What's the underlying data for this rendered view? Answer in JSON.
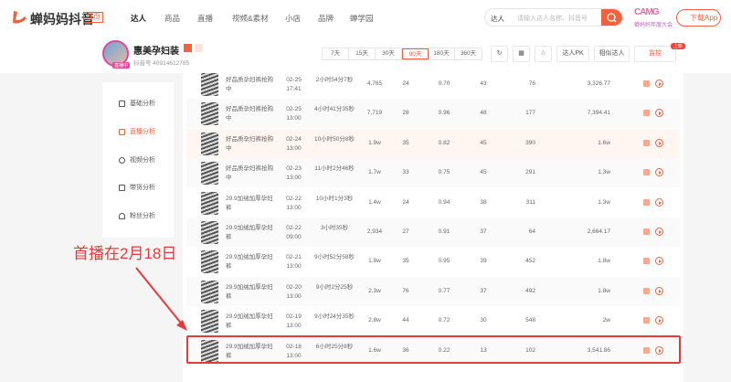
{
  "header": {
    "brand": "蝉妈妈抖音",
    "brand_tag": "首页",
    "nav": [
      "达人",
      "商品",
      "直播",
      "视频&素材",
      "小店",
      "品牌",
      "蝉学园"
    ],
    "search_type": "达人",
    "search_placeholder": "请输入达人名称、抖音号",
    "promo": "CAMG",
    "promo_sub": "蝉妈妈年度大会",
    "download": "下载App"
  },
  "profile": {
    "name": "惠美孕妇装",
    "live_badge": "直播中",
    "id": "抖音号 40914612785",
    "days": [
      "7天",
      "15天",
      "30天",
      "90天",
      "180天",
      "360天"
    ],
    "active_day": "90天",
    "pk": "达人PK",
    "similar": "相似达人",
    "monitor": "监控",
    "new_badge": "上新"
  },
  "sidebar": {
    "items": [
      {
        "label": "基础分析",
        "icon": "chart-icon"
      },
      {
        "label": "直播分析",
        "icon": "calendar-icon",
        "active": true
      },
      {
        "label": "视频分析",
        "icon": "play-icon"
      },
      {
        "label": "带货分析",
        "icon": "bag-icon"
      },
      {
        "label": "粉丝分析",
        "icon": "user-icon"
      }
    ]
  },
  "table": {
    "rows": [
      [
        "好品质孕妇裤抢购中",
        "02-25",
        "17:41",
        "2小时54分7秒",
        "4,765",
        "24",
        "0.70",
        "43",
        "76",
        "3,326.77"
      ],
      [
        "好品质孕妇裤抢购中",
        "02-25",
        "13:00",
        "4小时41分35秒",
        "7,719",
        "28",
        "0.96",
        "48",
        "177",
        "7,394.41"
      ],
      [
        "好品质孕妇裤抢购中",
        "02-24",
        "13:00",
        "10小时50分8秒",
        "1.9w",
        "35",
        "0.82",
        "45",
        "390",
        "1.6w"
      ],
      [
        "好品质孕妇裤抢购中",
        "02-23",
        "13:00",
        "11小时2分46秒",
        "1.7w",
        "33",
        "0.75",
        "45",
        "291",
        "1.3w"
      ],
      [
        "29.9加绒加厚孕妇裤",
        "02-22",
        "13:00",
        "10小时1分3秒",
        "1.4w",
        "24",
        "0.94",
        "38",
        "311",
        "1.3w"
      ],
      [
        "29.9加绒加厚孕妇裤",
        "02-22",
        "09:00",
        "3小时35秒",
        "2,934",
        "27",
        "0.91",
        "37",
        "64",
        "2,664.17"
      ],
      [
        "29.9加绒加厚孕妇裤",
        "02-21",
        "13:00",
        "9小时52分58秒",
        "1.8w",
        "35",
        "0.95",
        "39",
        "452",
        "1.8w"
      ],
      [
        "29.9加绒加厚孕妇裤",
        "02-20",
        "13:00",
        "9小时2分25秒",
        "2.3w",
        "76",
        "0.77",
        "37",
        "492",
        "1.8w"
      ],
      [
        "29.9加绒加厚孕妇裤",
        "02-19",
        "13:00",
        "9小时24分35秒",
        "2.8w",
        "44",
        "0.72",
        "30",
        "548",
        "2w"
      ],
      [
        "29.9加绒加厚孕妇裤",
        "02-18",
        "13:00",
        "6小时25分8秒",
        "1.6w",
        "36",
        "0.22",
        "13",
        "102",
        "3,541.86"
      ]
    ]
  },
  "annotation": {
    "text": "首播在2月18日",
    "color": "#e63a3a"
  },
  "accent": "#f0623d"
}
